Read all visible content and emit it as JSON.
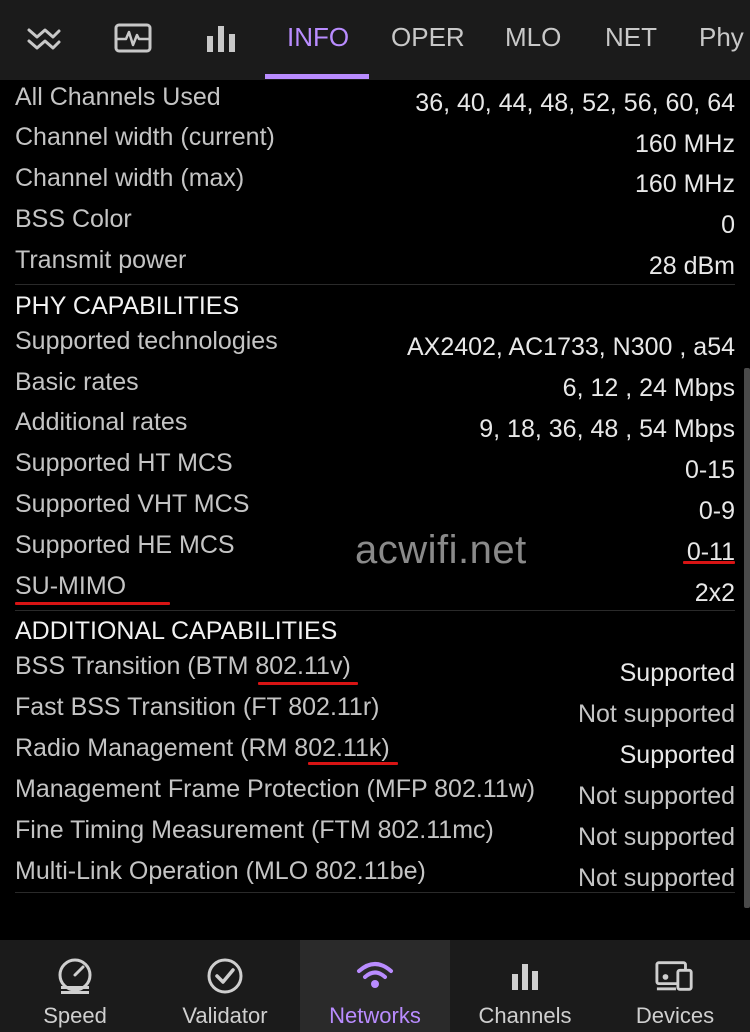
{
  "top_tabs": [
    {
      "icon": "signal-wave-icon"
    },
    {
      "icon": "pulse-monitor-icon"
    },
    {
      "icon": "bar-chart-icon"
    },
    {
      "label": "INFO",
      "active": true
    },
    {
      "label": "OPER"
    },
    {
      "label": "MLO"
    },
    {
      "label": "NET"
    },
    {
      "label": "Phy"
    }
  ],
  "radio_info": {
    "all_channels_label": "All Channels Used",
    "all_channels_value": "36, 40, 44, 48, 52, 56, 60, 64",
    "ch_width_current_label": "Channel width (current)",
    "ch_width_current_value": "160 MHz",
    "ch_width_max_label": "Channel width (max)",
    "ch_width_max_value": "160 MHz",
    "bss_color_label": "BSS Color",
    "bss_color_value": "0",
    "tx_power_label": "Transmit power",
    "tx_power_value": "28 dBm"
  },
  "phy": {
    "header": "PHY CAPABILITIES",
    "rows": [
      {
        "label": "Supported technologies",
        "value": "AX2402, AC1733, N300 , a54"
      },
      {
        "label": "Basic rates",
        "value": "6, 12 , 24 Mbps"
      },
      {
        "label": "Additional rates",
        "value": "9, 18, 36, 48 , 54 Mbps"
      },
      {
        "label": "Supported HT MCS",
        "value": "0-15"
      },
      {
        "label": "Supported VHT MCS",
        "value": "0-9"
      },
      {
        "label": "Supported HE MCS",
        "value": "0-11"
      },
      {
        "label": "SU-MIMO",
        "value": "2x2"
      }
    ]
  },
  "additional": {
    "header": "ADDITIONAL CAPABILITIES",
    "rows": [
      {
        "label": "BSS Transition (BTM 802.11v)",
        "value": "Supported"
      },
      {
        "label": "Fast BSS Transition (FT 802.11r)",
        "value": "Not supported"
      },
      {
        "label": "Radio Management (RM 802.11k)",
        "value": "Supported"
      },
      {
        "label": "Management Frame Protection (MFP 802.11w)",
        "value": "Not supported"
      },
      {
        "label": "Fine Timing Measurement (FTM 802.11mc)",
        "value": "Not supported"
      },
      {
        "label": "Multi-Link Operation (MLO 802.11be)",
        "value": "Not supported"
      }
    ]
  },
  "watermark": "acwifi.net",
  "bottom_nav": [
    {
      "label": "Speed",
      "icon": "speedometer-icon"
    },
    {
      "label": "Validator",
      "icon": "check-circle-icon"
    },
    {
      "label": "Networks",
      "icon": "wifi-icon",
      "active": true
    },
    {
      "label": "Channels",
      "icon": "bar-chart-icon"
    },
    {
      "label": "Devices",
      "icon": "devices-icon"
    }
  ],
  "colors": {
    "accent": "#b98cff",
    "annotation_red": "#d81414",
    "background": "#000000",
    "bar_background": "#1b1b1b"
  }
}
